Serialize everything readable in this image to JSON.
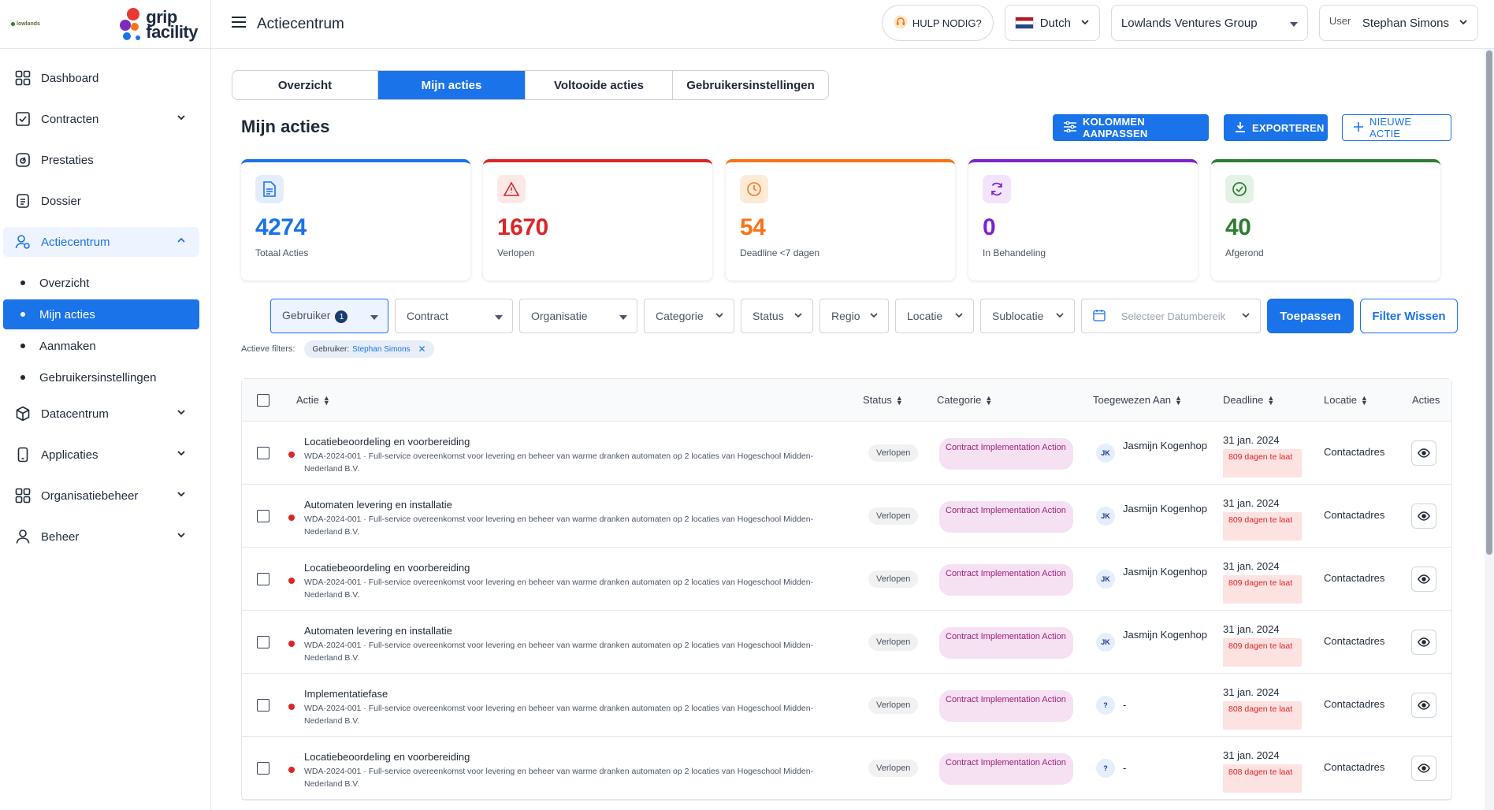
{
  "logos": {
    "small": "lowlands",
    "main_line1": "grip",
    "main_line2": "facility"
  },
  "sidebar": {
    "items": [
      {
        "label": "Dashboard",
        "icon": "dashboard-icon"
      },
      {
        "label": "Contracten",
        "icon": "contract-icon"
      },
      {
        "label": "Prestaties",
        "icon": "speedometer-icon"
      },
      {
        "label": "Dossier",
        "icon": "dossier-icon"
      },
      {
        "label": "Actiecentrum",
        "icon": "person-action-icon"
      },
      {
        "label": "Datacentrum",
        "icon": "cube-icon"
      },
      {
        "label": "Applicaties",
        "icon": "phone-icon"
      },
      {
        "label": "Organisatiebeheer",
        "icon": "grid-icon"
      },
      {
        "label": "Beheer",
        "icon": "user-icon"
      }
    ],
    "subitems": [
      "Overzicht",
      "Mijn acties",
      "Aanmaken",
      "Gebruikersinstellingen"
    ]
  },
  "topbar": {
    "title": "Actiecentrum",
    "help": "HULP NODIG?",
    "language": "Dutch",
    "organization": "Lowlands Ventures Group",
    "user_img_alt": "User",
    "user_name": "Stephan Simons"
  },
  "tabs": [
    "Overzicht",
    "Mijn acties",
    "Voltooide acties",
    "Gebruikersinstellingen"
  ],
  "section_title": "Mijn acties",
  "buttons": {
    "kolommen": "KOLOMMEN AANPASSEN",
    "export": "EXPORTEREN",
    "nieuw": "NIEUWE ACTIE"
  },
  "stats": [
    {
      "value": "4274",
      "label": "Totaal Acties",
      "color": "#1a73e8",
      "icon": "document-icon"
    },
    {
      "value": "1670",
      "label": "Verlopen",
      "color": "#dc2626",
      "icon": "warning-icon"
    },
    {
      "value": "54",
      "label": "Deadline <7 dagen",
      "color": "#f97316",
      "icon": "clock-icon"
    },
    {
      "value": "0",
      "label": "In Behandeling",
      "color": "#7e22ce",
      "icon": "refresh-icon"
    },
    {
      "value": "40",
      "label": "Afgerond",
      "color": "#2e7d32",
      "icon": "check-circle-icon"
    }
  ],
  "filters": {
    "gebruiker": "Gebruiker",
    "gebruiker_count": "1",
    "contract": "Contract",
    "organisatie": "Organisatie",
    "categorie": "Categorie",
    "status": "Status",
    "regio": "Regio",
    "locatie": "Locatie",
    "sublocatie": "Sublocatie",
    "datum": "Selecteer Datumbereik",
    "apply": "Toepassen",
    "clear": "Filter Wissen"
  },
  "active_filters": {
    "label": "Actieve filters:",
    "chip_key": "Gebruiker:",
    "chip_value": "Stephan Simons"
  },
  "table": {
    "headers": {
      "actie": "Actie",
      "status": "Status",
      "categorie": "Categorie",
      "toegewezen": "Toegewezen Aan",
      "deadline": "Deadline",
      "locatie": "Locatie",
      "acties": "Acties"
    },
    "rows": [
      {
        "title": "Locatiebeoordeling en voorbereiding",
        "desc": "WDA-2024-001 · Full-service overeenkomst voor levering en beheer van warme dranken automaten op 2 locaties van Hogeschool Midden-Nederland B.V.",
        "status": "Verlopen",
        "category": "Contract Implementation Action",
        "initials": "JK",
        "assignee": "Jasmijn Kogenhop",
        "deadline": "31 jan. 2024",
        "late": "809 dagen te laat",
        "location": "Contactadres"
      },
      {
        "title": "Automaten levering en installatie",
        "desc": "WDA-2024-001 · Full-service overeenkomst voor levering en beheer van warme dranken automaten op 2 locaties van Hogeschool Midden-Nederland B.V.",
        "status": "Verlopen",
        "category": "Contract Implementation Action",
        "initials": "JK",
        "assignee": "Jasmijn Kogenhop",
        "deadline": "31 jan. 2024",
        "late": "809 dagen te laat",
        "location": "Contactadres"
      },
      {
        "title": "Locatiebeoordeling en voorbereiding",
        "desc": "WDA-2024-001 · Full-service overeenkomst voor levering en beheer van warme dranken automaten op 2 locaties van Hogeschool Midden-Nederland B.V.",
        "status": "Verlopen",
        "category": "Contract Implementation Action",
        "initials": "JK",
        "assignee": "Jasmijn Kogenhop",
        "deadline": "31 jan. 2024",
        "late": "809 dagen te laat",
        "location": "Contactadres"
      },
      {
        "title": "Automaten levering en installatie",
        "desc": "WDA-2024-001 · Full-service overeenkomst voor levering en beheer van warme dranken automaten op 2 locaties van Hogeschool Midden-Nederland B.V.",
        "status": "Verlopen",
        "category": "Contract Implementation Action",
        "initials": "JK",
        "assignee": "Jasmijn Kogenhop",
        "deadline": "31 jan. 2024",
        "late": "809 dagen te laat",
        "location": "Contactadres"
      },
      {
        "title": "Implementatiefase",
        "desc": "WDA-2024-001 · Full-service overeenkomst voor levering en beheer van warme dranken automaten op 2 locaties van Hogeschool Midden-Nederland B.V.",
        "status": "Verlopen",
        "category": "Contract Implementation Action",
        "initials": "?",
        "assignee": "-",
        "deadline": "31 jan. 2024",
        "late": "808 dagen te laat",
        "location": "Contactadres"
      },
      {
        "title": "Locatiebeoordeling en voorbereiding",
        "desc": "WDA-2024-001 · Full-service overeenkomst voor levering en beheer van warme dranken automaten op 2 locaties van Hogeschool Midden-Nederland B.V.",
        "status": "Verlopen",
        "category": "Contract Implementation Action",
        "initials": "?",
        "assignee": "-",
        "deadline": "31 jan. 2024",
        "late": "808 dagen te laat",
        "location": "Contactadres"
      }
    ]
  }
}
